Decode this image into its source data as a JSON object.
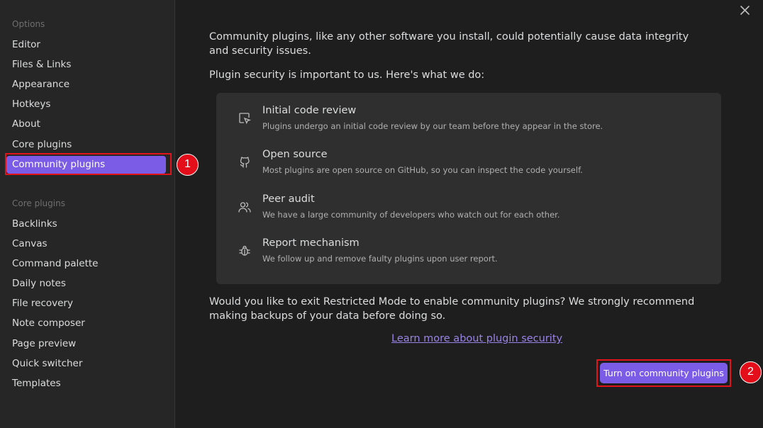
{
  "sidebar": {
    "options_title": "Options",
    "options_items": [
      "Editor",
      "Files & Links",
      "Appearance",
      "Hotkeys",
      "About",
      "Core plugins"
    ],
    "active_item": "Community plugins",
    "core_title": "Core plugins",
    "core_items": [
      "Backlinks",
      "Canvas",
      "Command palette",
      "Daily notes",
      "File recovery",
      "Note composer",
      "Page preview",
      "Quick switcher",
      "Templates"
    ]
  },
  "main": {
    "intro": "Community plugins, like any other software you install, could potentially cause data integrity and security issues.",
    "security_heading": "Plugin security is important to us. Here's what we do:",
    "features": [
      {
        "icon": "code-review-icon",
        "title": "Initial code review",
        "desc": "Plugins undergo an initial code review by our team before they appear in the store."
      },
      {
        "icon": "github-icon",
        "title": "Open source",
        "desc": "Most plugins are open source on GitHub, so you can inspect the code yourself."
      },
      {
        "icon": "users-icon",
        "title": "Peer audit",
        "desc": "We have a large community of developers who watch out for each other."
      },
      {
        "icon": "bug-icon",
        "title": "Report mechanism",
        "desc": "We follow up and remove faulty plugins upon user report."
      }
    ],
    "question": "Would you like to exit Restricted Mode to enable community plugins? We strongly recommend making backups of your data before doing so.",
    "learn_more": "Learn more about plugin security",
    "turn_on_button": "Turn on community plugins"
  },
  "annotations": {
    "badge_1": "1",
    "badge_2": "2"
  },
  "colors": {
    "accent": "#7b5ce6",
    "annotation_red": "#e0141a",
    "background": "#1e1e1e",
    "sidebar_bg": "#262626",
    "card_bg": "#2f2f2f",
    "link": "#9a83e8"
  }
}
